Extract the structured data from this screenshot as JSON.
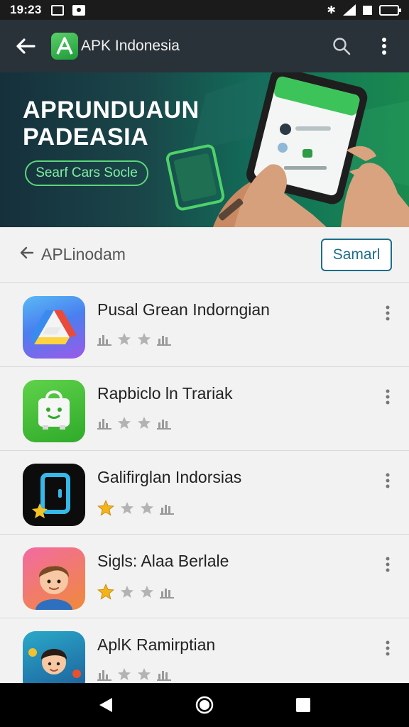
{
  "status_bar": {
    "time": "19:23"
  },
  "toolbar": {
    "title": "APK Indonesia"
  },
  "banner": {
    "title_line1": "APRUNDUAUN",
    "title_line2": "PADEASIA",
    "pill": "Searf Cars Socle"
  },
  "section": {
    "title": "APLinodam",
    "button": "Samarl"
  },
  "apps": [
    {
      "name": "Pusal Grean Indorngian",
      "rating_icon": "bar-chart-icon"
    },
    {
      "name": "Rapbiclo ln Trariak",
      "rating_icon": "bar-chart-icon"
    },
    {
      "name": "Galifirglan Indorsias",
      "rating_icon": "gold-star-icon"
    },
    {
      "name": "Sigls: Alaa Berlale",
      "rating_icon": "gold-star-icon"
    },
    {
      "name": "AplK Ramirptian",
      "rating_icon": "bar-chart-icon"
    }
  ],
  "colors": {
    "toolbar": "#293238",
    "accent_green": "#59d67a",
    "button_blue": "#1d6e8a",
    "star_gold": "#f2b418"
  }
}
